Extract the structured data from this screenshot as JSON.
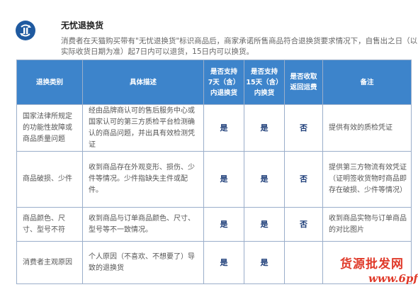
{
  "section": {
    "icon": "shield-refresh-icon",
    "title": "无忧退换货",
    "desc_line1": "消费者在天猫购买带有\"无忧退换货\"标识商品后，商家承诺所售商品符合退换货要求情况下，自售出之日（以",
    "desc_line2": "实际收货日期为准）起7日内可以退货，15日内可以换货。"
  },
  "table": {
    "headers": {
      "category": "退换类别",
      "detail": "具体描述",
      "return7": [
        "是否支持",
        "7天（含）",
        "内退换货"
      ],
      "exchange15": [
        "是否支持",
        "15天（含）",
        "内换货"
      ],
      "shipping": [
        "是否收取",
        "返回运费"
      ],
      "remark": "备注"
    },
    "rows": [
      {
        "category": "国家法律所规定的功能性故障或商品质量问题",
        "detail": "经由品牌商认可的售后服务中心或国家认可的第三方质检平台检测确认的商品问题，并出具有效检测凭证",
        "return7": "是",
        "exchange15": "是",
        "shipping": "否",
        "remark": "提供有效的质检凭证"
      },
      {
        "category": "商品破损、少件",
        "detail": "收到商品存在外观变形、损伤、少件等情况。少件指缺失主件或配件。",
        "return7": "是",
        "exchange15": "是",
        "shipping": "否",
        "remark": "提供第三方物流有效凭证（证明签收货物时商品即存在破损、少件等情况）"
      },
      {
        "category": "商品颜色、尺寸、型号不符",
        "detail": "收到商品与订单商品颜色、尺寸、型号等不一致情况。",
        "return7": "是",
        "exchange15": "是",
        "shipping": "否",
        "remark": "收到商品实物与订单商品的对比图片"
      },
      {
        "category": "消费者主观原因",
        "detail": "个人原因（不喜欢、不想要了）导致的退换货",
        "return7": "是",
        "exchange15": "是",
        "shipping": "",
        "remark": ""
      }
    ]
  },
  "watermark": {
    "brand": "货源批发网",
    "url": "www.6pf.cn"
  }
}
